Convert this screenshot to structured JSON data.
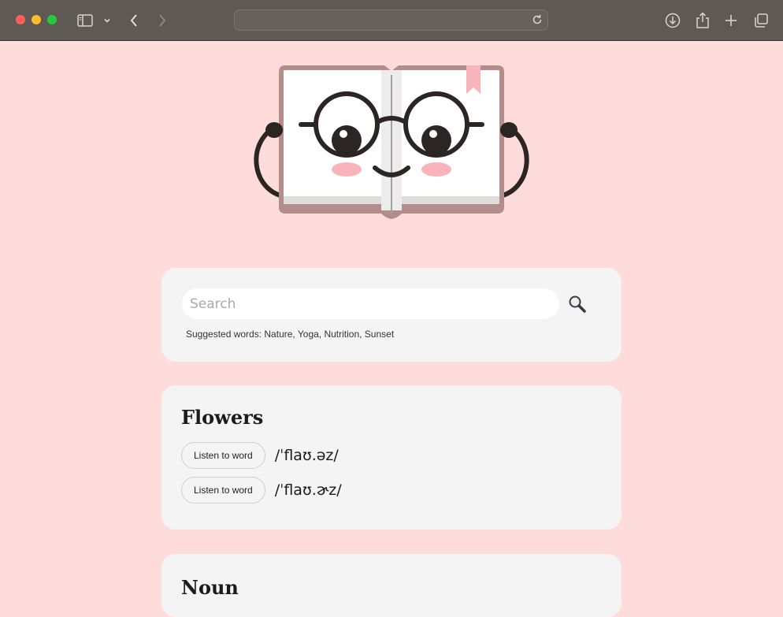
{
  "browser": {
    "address_value": "",
    "colors": {
      "chrome": "#5f5956",
      "close": "#fe5f57",
      "minimize": "#febc2e",
      "zoom": "#28c840"
    }
  },
  "page": {
    "colors": {
      "background": "#ffdcdc",
      "card": "#f4f4f4",
      "cheek": "#f9b4b9",
      "bookmark": "#f9b4b9",
      "book_cover": "#b38d8a"
    },
    "search": {
      "placeholder": "Search",
      "value": "",
      "suggested": "Suggested words: Nature, Yoga, Nutrition, Sunset"
    },
    "word": {
      "title": "Flowers",
      "pronunciations": [
        {
          "button": "Listen to word",
          "phonetic": "/ˈflaʊ.əz/"
        },
        {
          "button": "Listen to word",
          "phonetic": "/ˈflaʊ.ɚz/"
        }
      ]
    },
    "meaning": {
      "part_of_speech": "Noun"
    }
  }
}
